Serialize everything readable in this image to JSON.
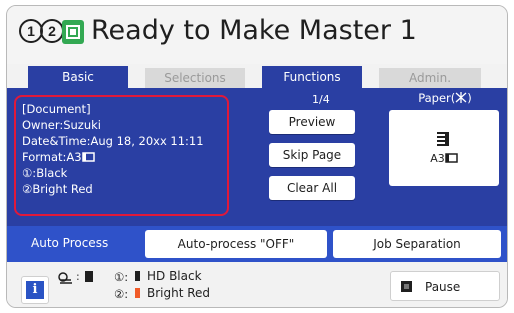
{
  "header": {
    "circle_numbers": [
      "1",
      "2"
    ],
    "icon": "master-making-icon",
    "title": "Ready to Make Master 1"
  },
  "tabs": [
    {
      "label": "Basic",
      "active": true
    },
    {
      "label": "Selections",
      "active": false
    },
    {
      "label": "Functions",
      "active": true
    },
    {
      "label": "Admin.",
      "active": false
    }
  ],
  "document_info": {
    "heading": "[Document]",
    "owner": "Owner:Suzuki",
    "datetime": "Date&Time:Aug 18, 20xx 11:11",
    "format": "Format:A3",
    "format_icon": "landscape-page-icon",
    "ink1": "Black",
    "ink2": "Bright Red"
  },
  "page_counter": "1/4",
  "actions": {
    "preview": "Preview",
    "skip_page": "Skip Page",
    "clear_all": "Clear All"
  },
  "paper": {
    "label": "Paper(",
    "label_suffix": ")",
    "label_icon": "auto-select-icon",
    "icon": "paper-stack-icon",
    "size": "A3"
  },
  "auto_process": {
    "label": "Auto Process",
    "status_button": "Auto-process \"OFF\"",
    "job_separation": "Job Separation"
  },
  "status_bar": {
    "info_icon": "i",
    "drum_icon": "drum-icon",
    "ink1_num": "①:",
    "ink1_name": "HD Black",
    "ink2_num": "②:",
    "ink2_name": "Bright Red",
    "pause": "Pause"
  },
  "colors": {
    "accent_blue": "#2a3fa3",
    "auto_row_blue": "#2f52c9",
    "highlight_red": "#e0193a",
    "ink_black": "#1f1f1f",
    "ink_red": "#f05a28",
    "icon_green": "#32a852"
  }
}
